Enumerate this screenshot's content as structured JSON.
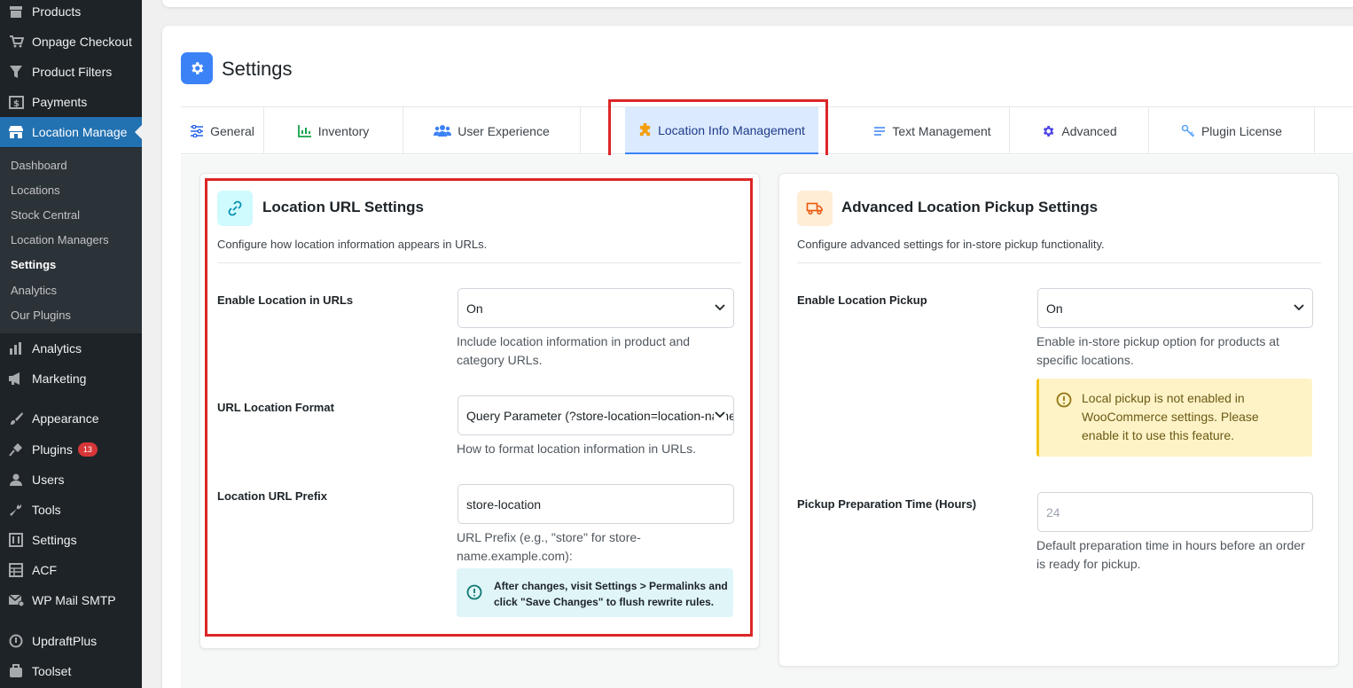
{
  "sidebar": {
    "menu": [
      {
        "label": "Products",
        "icon": "archive-icon"
      },
      {
        "label": "Onpage Checkout",
        "icon": "cart-icon"
      },
      {
        "label": "Product Filters",
        "icon": "filter-icon"
      },
      {
        "label": "Payments",
        "icon": "dollar-icon"
      },
      {
        "label": "Location Manage",
        "icon": "location-store-icon",
        "active": true
      },
      {
        "label": "Analytics",
        "icon": "bar-chart-icon"
      },
      {
        "label": "Marketing",
        "icon": "megaphone-icon"
      },
      {
        "label": "Appearance",
        "icon": "paintbrush-icon"
      },
      {
        "label": "Plugins",
        "icon": "plugin-icon",
        "badge": "13"
      },
      {
        "label": "Users",
        "icon": "users-icon"
      },
      {
        "label": "Tools",
        "icon": "wrench-icon"
      },
      {
        "label": "Settings",
        "icon": "sliders-icon"
      },
      {
        "label": "ACF",
        "icon": "acf-grid-icon"
      },
      {
        "label": "WP Mail SMTP",
        "icon": "mail-icon"
      },
      {
        "label": "UpdraftPlus",
        "icon": "updraft-icon"
      },
      {
        "label": "Toolset",
        "icon": "toolset-icon"
      }
    ],
    "submenu": [
      "Dashboard",
      "Locations",
      "Stock Central",
      "Location Managers",
      "Settings",
      "Analytics",
      "Our Plugins"
    ],
    "submenu_current": "Settings"
  },
  "page": {
    "title": "Settings"
  },
  "tabs": [
    {
      "label": "General",
      "icon": "sliders-icon"
    },
    {
      "label": "Inventory",
      "icon": "chart-icon"
    },
    {
      "label": "User Experience",
      "icon": "users-icon"
    },
    {
      "label": "Location Info Management",
      "icon": "puzzle-icon",
      "active": true
    },
    {
      "label": "Text Management",
      "icon": "text-lines-icon"
    },
    {
      "label": "Advanced",
      "icon": "gear-icon"
    },
    {
      "label": "Plugin License",
      "icon": "key-icon"
    }
  ],
  "url_panel": {
    "title": "Location URL Settings",
    "description": "Configure how location information appears in URLs.",
    "enable_label": "Enable Location in URLs",
    "enable_value": "On",
    "enable_help": "Include location information in product and category URLs.",
    "format_label": "URL Location Format",
    "format_value": "Query Parameter (?store-location=location-name)",
    "format_help": "How to format location information in URLs.",
    "prefix_label": "Location URL Prefix",
    "prefix_value": "store-location",
    "prefix_help": "URL Prefix (e.g., \"store\" for store-name.example.com):",
    "notice": "After changes, visit Settings > Permalinks and click \"Save Changes\" to flush rewrite rules."
  },
  "pickup_panel": {
    "title": "Advanced Location Pickup Settings",
    "description": "Configure advanced settings for in-store pickup functionality.",
    "enable_label": "Enable Location Pickup",
    "enable_value": "On",
    "enable_help": "Enable in-store pickup option for products at specific locations.",
    "warning": "Local pickup is not enabled in WooCommerce settings. Please enable it to use this feature.",
    "prep_label": "Pickup Preparation Time (Hours)",
    "prep_placeholder": "24",
    "prep_help": "Default preparation time in hours before an order is ready for pickup."
  },
  "colors": {
    "accent": "#3b82f6",
    "wp_sidebar": "#1d2327",
    "wp_active": "#2271b1",
    "highlight_red": "#dc2626",
    "warning_bg": "#fef3c7"
  }
}
